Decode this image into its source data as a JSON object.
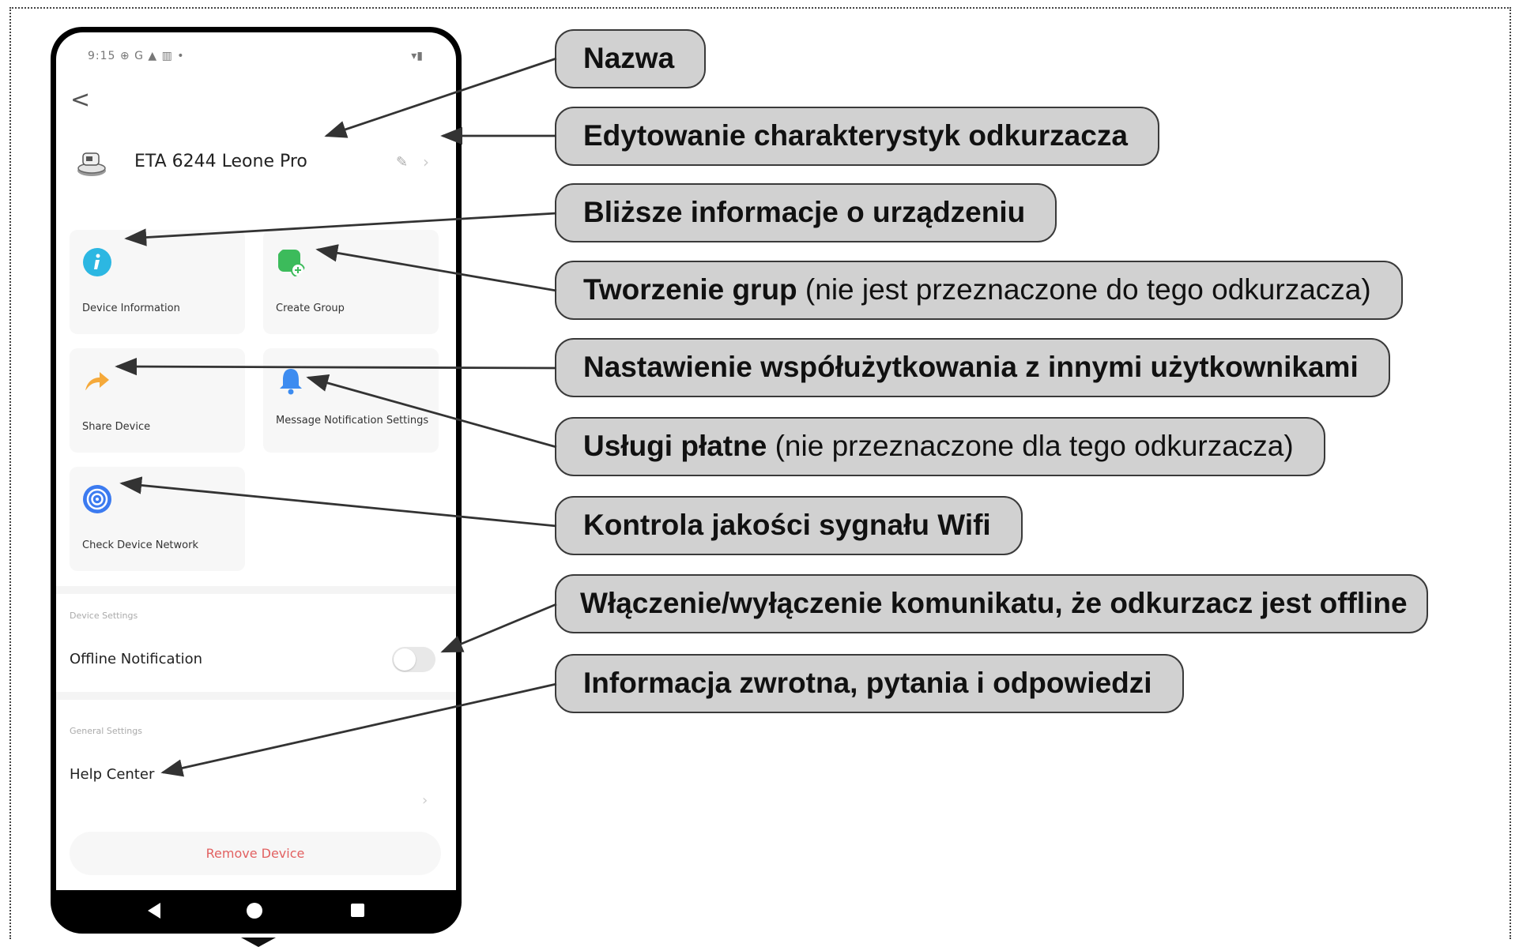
{
  "phone": {
    "status_time": "9:15 ⊕ G ▲ ▥ •",
    "status_right": "▾▮",
    "back_glyph": "<",
    "device_name": "ETA 6244 Leone Pro",
    "edit_glyph": "✎",
    "chevron_glyph": "›",
    "cards": [
      {
        "label": "Device Information",
        "icon": "info-icon",
        "color": "#2cb7e2"
      },
      {
        "label": "Create Group",
        "icon": "create-group-icon",
        "color": "#3cbb5b"
      },
      {
        "label": "Share Device",
        "icon": "share-arrow-icon",
        "color": "#f5a93a"
      },
      {
        "label": "Message Notification Settings",
        "icon": "bell-icon",
        "color": "#3d8cf0"
      },
      {
        "label": "Check Device Network",
        "icon": "network-signal-icon",
        "color": "#3c7bf0"
      }
    ],
    "device_settings_label": "Device Settings",
    "offline_notification_label": "Offline Notification",
    "offline_notification_on": false,
    "general_settings_label": "General Settings",
    "help_center_label": "Help Center",
    "remove_device_label": "Remove Device"
  },
  "callouts": [
    {
      "bold": "Nazwa",
      "normal": ""
    },
    {
      "bold": "Edytowanie charakterystyk odkurzacza",
      "normal": ""
    },
    {
      "bold": "Bliższe informacje o urządzeniu",
      "normal": ""
    },
    {
      "bold": "Tworzenie grup",
      "normal": " (nie jest przeznaczone do tego odkurzacza)"
    },
    {
      "bold": "Nastawienie współużytkowania z innymi użytkownikami",
      "normal": ""
    },
    {
      "bold": "Usługi płatne",
      "normal": " (nie przeznaczone dla tego odkurzacza)"
    },
    {
      "bold": "Kontrola jakości sygnału Wifi",
      "normal": ""
    },
    {
      "bold": "Włączenie/wyłączenie komunikatu, że odkurzacz jest offline",
      "normal": ""
    },
    {
      "bold": "Informacja zwrotna, pytania i odpowiedzi",
      "normal": ""
    }
  ],
  "colors": {
    "callout_fill": "#d1d1d1",
    "callout_border": "#3a3a3a",
    "remove_text": "#e26161"
  }
}
